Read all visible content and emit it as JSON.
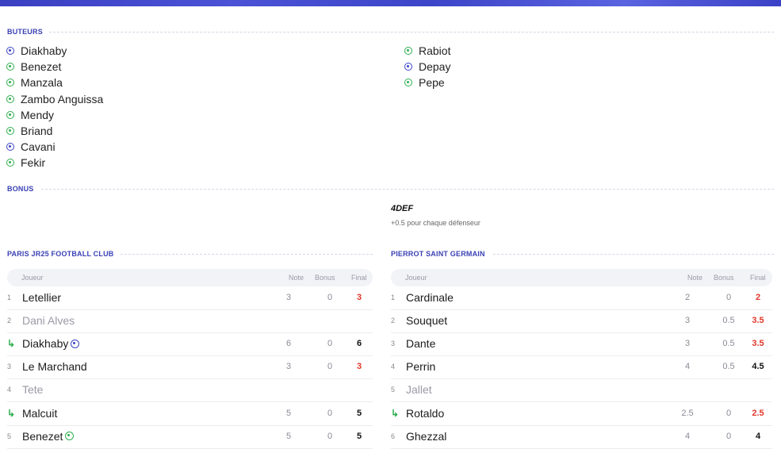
{
  "sections": {
    "scorers": "BUTEURS",
    "bonus": "BONUS"
  },
  "scorers_left": [
    {
      "name": "Diakhaby",
      "ball": "blue"
    },
    {
      "name": "Benezet",
      "ball": "green"
    },
    {
      "name": "Manzala",
      "ball": "green"
    },
    {
      "name": "Zambo Anguissa",
      "ball": "green"
    },
    {
      "name": "Mendy",
      "ball": "green"
    },
    {
      "name": "Briand",
      "ball": "green"
    },
    {
      "name": "Cavani",
      "ball": "blue"
    },
    {
      "name": "Fekir",
      "ball": "green"
    }
  ],
  "scorers_right": [
    {
      "name": "Rabiot",
      "ball": "green"
    },
    {
      "name": "Depay",
      "ball": "blue"
    },
    {
      "name": "Pepe",
      "ball": "green"
    }
  ],
  "bonus": {
    "name": "4DEF",
    "desc": "+0.5 pour chaque défenseur"
  },
  "teams": [
    {
      "title": "PARIS JR25 FOOTBALL CLUB",
      "headers": {
        "player": "Joueur",
        "note": "Note",
        "bonus": "Bonus",
        "final": "Final"
      },
      "rows": [
        {
          "rank": "1",
          "name": "Letellier",
          "note": "3",
          "bonus": "0",
          "final": "3",
          "final_color": "red"
        },
        {
          "rank": "2",
          "name": "Dani Alves",
          "dim": true
        },
        {
          "sub": true,
          "name": "Diakhaby",
          "ball": "blue",
          "note": "6",
          "bonus": "0",
          "final": "6",
          "final_color": "black"
        },
        {
          "rank": "3",
          "name": "Le Marchand",
          "note": "3",
          "bonus": "0",
          "final": "3",
          "final_color": "red"
        },
        {
          "rank": "4",
          "name": "Tete",
          "dim": true
        },
        {
          "sub": true,
          "name": "Malcuit",
          "note": "5",
          "bonus": "0",
          "final": "5",
          "final_color": "black"
        },
        {
          "rank": "5",
          "name": "Benezet",
          "ball": "green",
          "note": "5",
          "bonus": "0",
          "final": "5",
          "final_color": "black"
        }
      ]
    },
    {
      "title": "PIERROT SAINT GERMAIN",
      "headers": {
        "player": "Joueur",
        "note": "Note",
        "bonus": "Bonus",
        "final": "Final"
      },
      "rows": [
        {
          "rank": "1",
          "name": "Cardinale",
          "note": "2",
          "bonus": "0",
          "final": "2",
          "final_color": "red"
        },
        {
          "rank": "2",
          "name": "Souquet",
          "note": "3",
          "bonus": "0.5",
          "final": "3.5",
          "final_color": "red"
        },
        {
          "rank": "3",
          "name": "Dante",
          "note": "3",
          "bonus": "0.5",
          "final": "3.5",
          "final_color": "red"
        },
        {
          "rank": "4",
          "name": "Perrin",
          "note": "4",
          "bonus": "0.5",
          "final": "4.5",
          "final_color": "black"
        },
        {
          "rank": "5",
          "name": "Jallet",
          "dim": true
        },
        {
          "sub": true,
          "name": "Rotaldo",
          "note": "2.5",
          "bonus": "0",
          "final": "2.5",
          "final_color": "red"
        },
        {
          "rank": "6",
          "name": "Ghezzal",
          "note": "4",
          "bonus": "0",
          "final": "4",
          "final_color": "black"
        }
      ]
    }
  ],
  "colors": {
    "accent": "#3a41b5",
    "green": "#2fae4f",
    "blue": "#3b44c4",
    "red": "#e0382b"
  }
}
